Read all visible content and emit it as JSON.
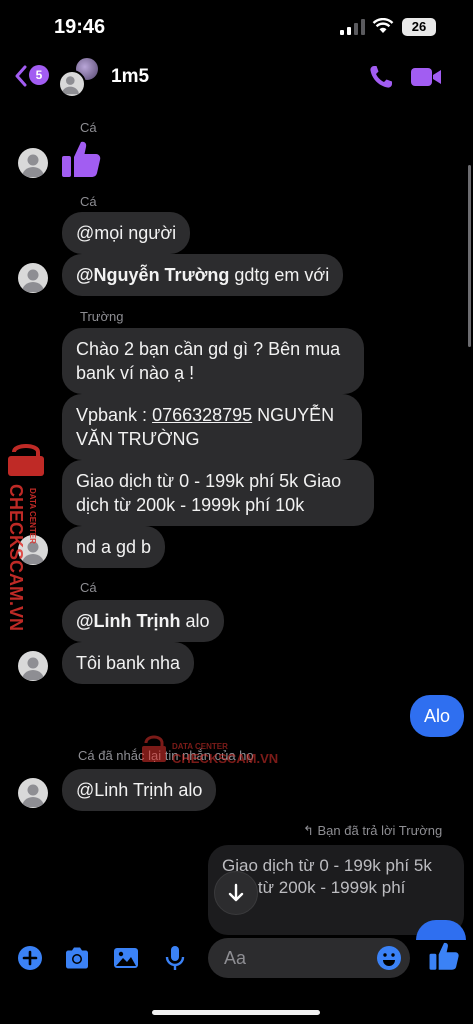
{
  "status_bar": {
    "time": "19:46",
    "battery": "26"
  },
  "header": {
    "back_badge": "5",
    "group_name": "1m5"
  },
  "messages": {
    "s1_sender": "Cá",
    "s2_sender": "Cá",
    "s2_m1": "@mọi người",
    "s2_m2_mention": "@Nguyễn Trường",
    "s2_m2_text": " gdtg em với",
    "s3_sender": "Trường",
    "s3_m1_line1": "Chào 2 bạn cần gd gì ? Bên mua",
    "s3_m1_line2": "bank ví nào ạ !",
    "s3_m2_prefix": "Vpbank : ",
    "s3_m2_phone": "0766328795",
    "s3_m2_suffix": " NGUYỄN",
    "s3_m2_line2": "VĂN TRƯỜNG",
    "s3_m3_line1": "Giao dịch từ 0 - 199k phí 5k  Giao",
    "s3_m3_line2": "dịch từ 200k - 1999k phí 10k",
    "s3_m4": "nd a gd b",
    "s4_sender": "Cá",
    "s4_m1_mention": "@Linh Trịnh",
    "s4_m1_text": " alo",
    "s4_m2": "Tôi bank nha",
    "me_m1": "Alo",
    "note_mention": "Cá đã nhắc lại tin nhắn của họ",
    "s5_m1": "@Linh Trịnh alo",
    "reply_note": "Bạn đã trả lời Trường",
    "reply_line1": "Giao dịch từ 0 - 199k phí 5k",
    "reply_line2": "dịch từ 200k - 1999k phí"
  },
  "watermark": {
    "brand": "CHECKSCAM.VN",
    "tag": "DATA CENTER"
  },
  "composer": {
    "placeholder": "Aa"
  },
  "colors": {
    "accent": "#a25df2",
    "bubble": "#2c2c2e",
    "my_bubble": "#2f6ff0",
    "composer_icon": "#3b82f6"
  }
}
